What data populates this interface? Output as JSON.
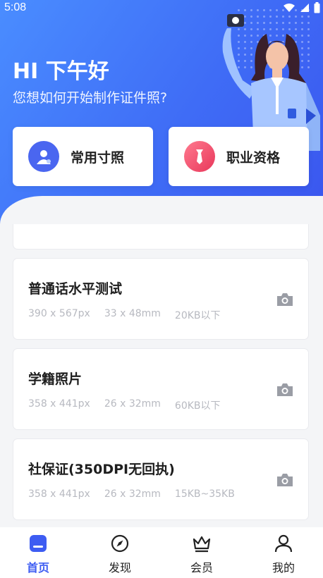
{
  "status": {
    "time": "5:08"
  },
  "header": {
    "greeting": "HI 下午好",
    "subtitle": "您想如何开始制作证件照?"
  },
  "quick_actions": [
    {
      "label": "常用寸照",
      "icon": "person-icon",
      "color": "#4a66f0"
    },
    {
      "label": "职业资格",
      "icon": "tie-icon",
      "color": "#f24a6c"
    }
  ],
  "items": [
    {
      "title": "普通话水平测试",
      "pixels": "390 x 567px",
      "mm": "33 x 48mm",
      "size": "20KB以下"
    },
    {
      "title": "学籍照片",
      "pixels": "358 x 441px",
      "mm": "26 x 32mm",
      "size": "60KB以下"
    },
    {
      "title": "社保证(350DPI无回执)",
      "pixels": "358 x 441px",
      "mm": "26 x 32mm",
      "size": "15KB~35KB"
    }
  ],
  "tabs": [
    {
      "label": "首页",
      "icon": "home-icon",
      "active": true
    },
    {
      "label": "发现",
      "icon": "compass-icon",
      "active": false
    },
    {
      "label": "会员",
      "icon": "crown-icon",
      "active": false
    },
    {
      "label": "我的",
      "icon": "user-icon",
      "active": false
    }
  ],
  "colors": {
    "accent": "#3d5cf2",
    "header_start": "#4a8dff",
    "header_end": "#3a55ee"
  }
}
